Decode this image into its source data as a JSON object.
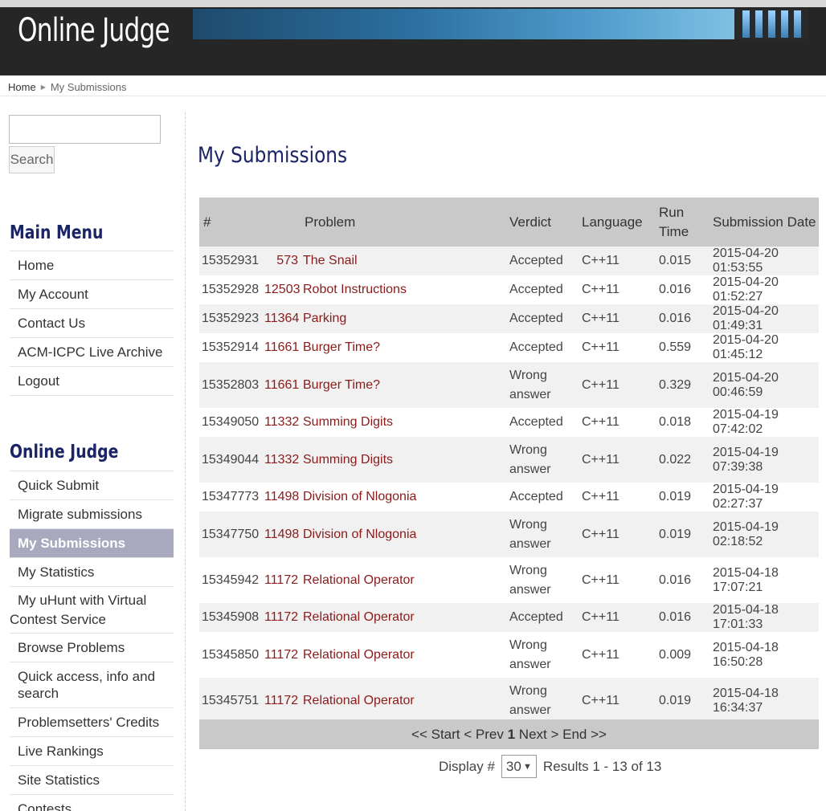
{
  "header": {
    "site_title": "Online Judge"
  },
  "breadcrumb": {
    "home": "Home",
    "separator": "▶",
    "current": "My Submissions"
  },
  "search": {
    "value": "",
    "button_label": "Search"
  },
  "main_menu": {
    "title": "Main Menu",
    "items": [
      "Home",
      "My Account",
      "Contact Us",
      "ACM-ICPC Live Archive",
      "Logout"
    ]
  },
  "judge_menu": {
    "title": "Online Judge",
    "items": [
      "Quick Submit",
      "Migrate submissions",
      "My Submissions",
      "My Statistics",
      "My uHunt with Virtual Contest Service",
      "Browse Problems",
      "Quick access, info and search",
      "Problemsetters' Credits",
      "Live Rankings",
      "Site Statistics",
      "Contests"
    ],
    "active_index": 2
  },
  "page": {
    "title": "My Submissions"
  },
  "table": {
    "headers": {
      "num": "#",
      "problem": "Problem",
      "verdict": "Verdict",
      "language": "Language",
      "run_time": "Run Time",
      "date": "Submission Date"
    },
    "rows": [
      {
        "id": "15352931",
        "pnum": "573",
        "ptitle": "The Snail",
        "verdict": "Accepted",
        "lang": "C++11",
        "time": "0.015",
        "date": "2015-04-20 01:53:55"
      },
      {
        "id": "15352928",
        "pnum": "12503",
        "ptitle": "Robot Instructions",
        "verdict": "Accepted",
        "lang": "C++11",
        "time": "0.016",
        "date": "2015-04-20 01:52:27"
      },
      {
        "id": "15352923",
        "pnum": "11364",
        "ptitle": "Parking",
        "verdict": "Accepted",
        "lang": "C++11",
        "time": "0.016",
        "date": "2015-04-20 01:49:31"
      },
      {
        "id": "15352914",
        "pnum": "11661",
        "ptitle": "Burger Time?",
        "verdict": "Accepted",
        "lang": "C++11",
        "time": "0.559",
        "date": "2015-04-20 01:45:12"
      },
      {
        "id": "15352803",
        "pnum": "11661",
        "ptitle": "Burger Time?",
        "verdict": "Wrong answer",
        "lang": "C++11",
        "time": "0.329",
        "date": "2015-04-20 00:46:59"
      },
      {
        "id": "15349050",
        "pnum": "11332",
        "ptitle": "Summing Digits",
        "verdict": "Accepted",
        "lang": "C++11",
        "time": "0.018",
        "date": "2015-04-19 07:42:02"
      },
      {
        "id": "15349044",
        "pnum": "11332",
        "ptitle": "Summing Digits",
        "verdict": "Wrong answer",
        "lang": "C++11",
        "time": "0.022",
        "date": "2015-04-19 07:39:38"
      },
      {
        "id": "15347773",
        "pnum": "11498",
        "ptitle": "Division of Nlogonia",
        "verdict": "Accepted",
        "lang": "C++11",
        "time": "0.019",
        "date": "2015-04-19 02:27:37"
      },
      {
        "id": "15347750",
        "pnum": "11498",
        "ptitle": "Division of Nlogonia",
        "verdict": "Wrong answer",
        "lang": "C++11",
        "time": "0.019",
        "date": "2015-04-19 02:18:52"
      },
      {
        "id": "15345942",
        "pnum": "11172",
        "ptitle": "Relational Operator",
        "verdict": "Wrong answer",
        "lang": "C++11",
        "time": "0.016",
        "date": "2015-04-18 17:07:21"
      },
      {
        "id": "15345908",
        "pnum": "11172",
        "ptitle": "Relational Operator",
        "verdict": "Accepted",
        "lang": "C++11",
        "time": "0.016",
        "date": "2015-04-18 17:01:33"
      },
      {
        "id": "15345850",
        "pnum": "11172",
        "ptitle": "Relational Operator",
        "verdict": "Wrong answer",
        "lang": "C++11",
        "time": "0.009",
        "date": "2015-04-18 16:50:28"
      },
      {
        "id": "15345751",
        "pnum": "11172",
        "ptitle": "Relational Operator",
        "verdict": "Wrong answer",
        "lang": "C++11",
        "time": "0.019",
        "date": "2015-04-18 16:34:37"
      }
    ]
  },
  "pager": {
    "start": "<< Start",
    "prev": "< Prev",
    "page": "1",
    "next": "Next >",
    "end": "End >>"
  },
  "display": {
    "label": "Display #",
    "value": "30",
    "results": "Results 1 - 13 of 13"
  }
}
